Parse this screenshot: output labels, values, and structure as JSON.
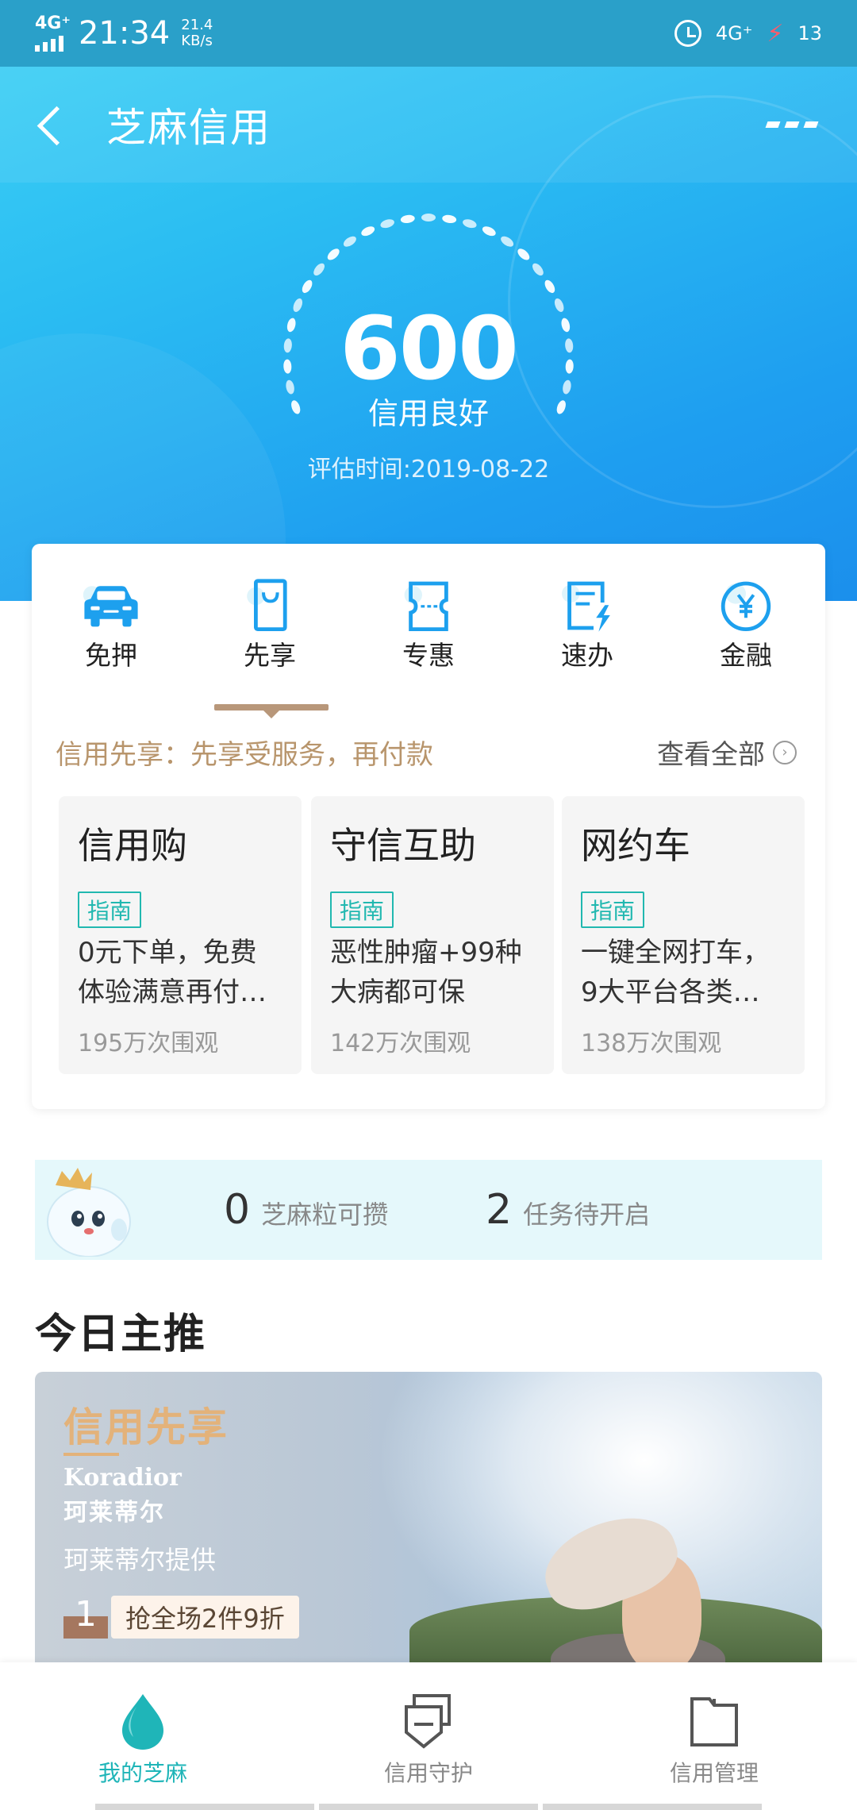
{
  "status_bar": {
    "network": "4G⁺",
    "time": "21:34",
    "speed_value": "21.4",
    "speed_unit": "KB/s",
    "network_right": "4G⁺",
    "battery": "13"
  },
  "nav": {
    "title": "芝麻信用"
  },
  "score": {
    "value": "600",
    "level": "信用良好",
    "date": "评估时间:2019-08-22"
  },
  "services": {
    "tabs": [
      {
        "label": "免押",
        "icon": "car-icon"
      },
      {
        "label": "先享",
        "icon": "shopping-bag-icon"
      },
      {
        "label": "专惠",
        "icon": "coupon-icon"
      },
      {
        "label": "速办",
        "icon": "fast-document-icon"
      },
      {
        "label": "金融",
        "icon": "yen-icon"
      }
    ],
    "active_tab": "先享",
    "promo": "信用先享：先享受服务，再付款",
    "view_all": "查看全部",
    "cards": [
      {
        "title": "信用购",
        "tag": "指南",
        "desc": "0元下单，免费体验满意再付…",
        "views": "195万次围观"
      },
      {
        "title": "守信互助",
        "tag": "指南",
        "desc": "恶性肿瘤+99种大病都可保",
        "views": "142万次围观"
      },
      {
        "title": "网约车",
        "tag": "指南",
        "desc": "一键全网打车，9大平台各类…",
        "views": "138万次围观"
      }
    ]
  },
  "sesame": {
    "grains_num": "0",
    "grains_label": "芝麻粒可攒",
    "tasks_num": "2",
    "tasks_label": "任务待开启"
  },
  "today": {
    "title": "今日主推",
    "banner": {
      "tag": "信用先享",
      "brand_en": "Koradior",
      "brand_cn": "珂莱蒂尔",
      "provider": "珂莱蒂尔提供",
      "rank": "1",
      "offer": "抢全场2件9折"
    }
  },
  "bottom_nav": [
    {
      "label": "我的芝麻",
      "icon": "sesame-drop-icon",
      "active": true
    },
    {
      "label": "信用守护",
      "icon": "shield-cards-icon",
      "active": false
    },
    {
      "label": "信用管理",
      "icon": "folder-icon",
      "active": false
    }
  ],
  "colors": {
    "accent": "#1fb5b8",
    "gold": "#b8956c",
    "hero_blue": "#2bbdf2"
  }
}
